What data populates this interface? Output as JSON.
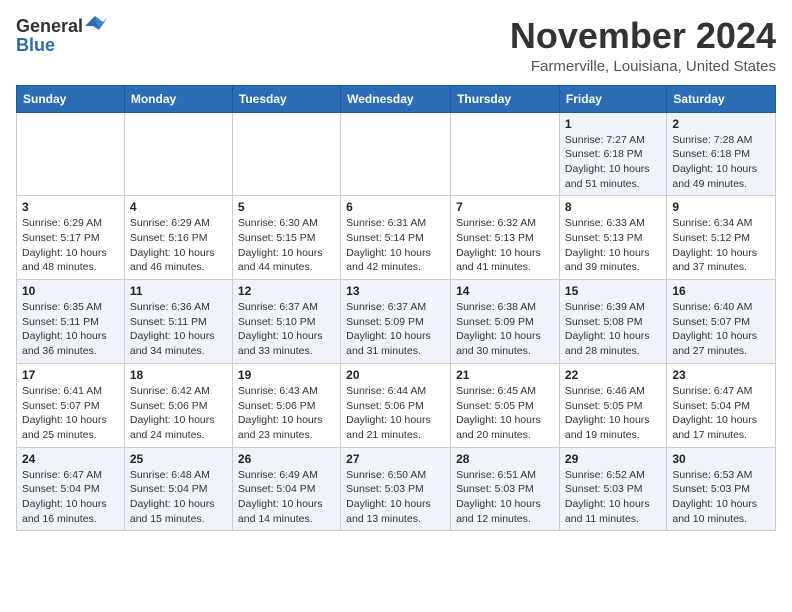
{
  "header": {
    "logo_general": "General",
    "logo_blue": "Blue",
    "month_title": "November 2024",
    "location": "Farmerville, Louisiana, United States"
  },
  "days_of_week": [
    "Sunday",
    "Monday",
    "Tuesday",
    "Wednesday",
    "Thursday",
    "Friday",
    "Saturday"
  ],
  "weeks": [
    [
      {
        "day": "",
        "info": ""
      },
      {
        "day": "",
        "info": ""
      },
      {
        "day": "",
        "info": ""
      },
      {
        "day": "",
        "info": ""
      },
      {
        "day": "",
        "info": ""
      },
      {
        "day": "1",
        "info": "Sunrise: 7:27 AM\nSunset: 6:18 PM\nDaylight: 10 hours and 51 minutes."
      },
      {
        "day": "2",
        "info": "Sunrise: 7:28 AM\nSunset: 6:18 PM\nDaylight: 10 hours and 49 minutes."
      }
    ],
    [
      {
        "day": "3",
        "info": "Sunrise: 6:29 AM\nSunset: 5:17 PM\nDaylight: 10 hours and 48 minutes."
      },
      {
        "day": "4",
        "info": "Sunrise: 6:29 AM\nSunset: 5:16 PM\nDaylight: 10 hours and 46 minutes."
      },
      {
        "day": "5",
        "info": "Sunrise: 6:30 AM\nSunset: 5:15 PM\nDaylight: 10 hours and 44 minutes."
      },
      {
        "day": "6",
        "info": "Sunrise: 6:31 AM\nSunset: 5:14 PM\nDaylight: 10 hours and 42 minutes."
      },
      {
        "day": "7",
        "info": "Sunrise: 6:32 AM\nSunset: 5:13 PM\nDaylight: 10 hours and 41 minutes."
      },
      {
        "day": "8",
        "info": "Sunrise: 6:33 AM\nSunset: 5:13 PM\nDaylight: 10 hours and 39 minutes."
      },
      {
        "day": "9",
        "info": "Sunrise: 6:34 AM\nSunset: 5:12 PM\nDaylight: 10 hours and 37 minutes."
      }
    ],
    [
      {
        "day": "10",
        "info": "Sunrise: 6:35 AM\nSunset: 5:11 PM\nDaylight: 10 hours and 36 minutes."
      },
      {
        "day": "11",
        "info": "Sunrise: 6:36 AM\nSunset: 5:11 PM\nDaylight: 10 hours and 34 minutes."
      },
      {
        "day": "12",
        "info": "Sunrise: 6:37 AM\nSunset: 5:10 PM\nDaylight: 10 hours and 33 minutes."
      },
      {
        "day": "13",
        "info": "Sunrise: 6:37 AM\nSunset: 5:09 PM\nDaylight: 10 hours and 31 minutes."
      },
      {
        "day": "14",
        "info": "Sunrise: 6:38 AM\nSunset: 5:09 PM\nDaylight: 10 hours and 30 minutes."
      },
      {
        "day": "15",
        "info": "Sunrise: 6:39 AM\nSunset: 5:08 PM\nDaylight: 10 hours and 28 minutes."
      },
      {
        "day": "16",
        "info": "Sunrise: 6:40 AM\nSunset: 5:07 PM\nDaylight: 10 hours and 27 minutes."
      }
    ],
    [
      {
        "day": "17",
        "info": "Sunrise: 6:41 AM\nSunset: 5:07 PM\nDaylight: 10 hours and 25 minutes."
      },
      {
        "day": "18",
        "info": "Sunrise: 6:42 AM\nSunset: 5:06 PM\nDaylight: 10 hours and 24 minutes."
      },
      {
        "day": "19",
        "info": "Sunrise: 6:43 AM\nSunset: 5:06 PM\nDaylight: 10 hours and 23 minutes."
      },
      {
        "day": "20",
        "info": "Sunrise: 6:44 AM\nSunset: 5:06 PM\nDaylight: 10 hours and 21 minutes."
      },
      {
        "day": "21",
        "info": "Sunrise: 6:45 AM\nSunset: 5:05 PM\nDaylight: 10 hours and 20 minutes."
      },
      {
        "day": "22",
        "info": "Sunrise: 6:46 AM\nSunset: 5:05 PM\nDaylight: 10 hours and 19 minutes."
      },
      {
        "day": "23",
        "info": "Sunrise: 6:47 AM\nSunset: 5:04 PM\nDaylight: 10 hours and 17 minutes."
      }
    ],
    [
      {
        "day": "24",
        "info": "Sunrise: 6:47 AM\nSunset: 5:04 PM\nDaylight: 10 hours and 16 minutes."
      },
      {
        "day": "25",
        "info": "Sunrise: 6:48 AM\nSunset: 5:04 PM\nDaylight: 10 hours and 15 minutes."
      },
      {
        "day": "26",
        "info": "Sunrise: 6:49 AM\nSunset: 5:04 PM\nDaylight: 10 hours and 14 minutes."
      },
      {
        "day": "27",
        "info": "Sunrise: 6:50 AM\nSunset: 5:03 PM\nDaylight: 10 hours and 13 minutes."
      },
      {
        "day": "28",
        "info": "Sunrise: 6:51 AM\nSunset: 5:03 PM\nDaylight: 10 hours and 12 minutes."
      },
      {
        "day": "29",
        "info": "Sunrise: 6:52 AM\nSunset: 5:03 PM\nDaylight: 10 hours and 11 minutes."
      },
      {
        "day": "30",
        "info": "Sunrise: 6:53 AM\nSunset: 5:03 PM\nDaylight: 10 hours and 10 minutes."
      }
    ]
  ]
}
